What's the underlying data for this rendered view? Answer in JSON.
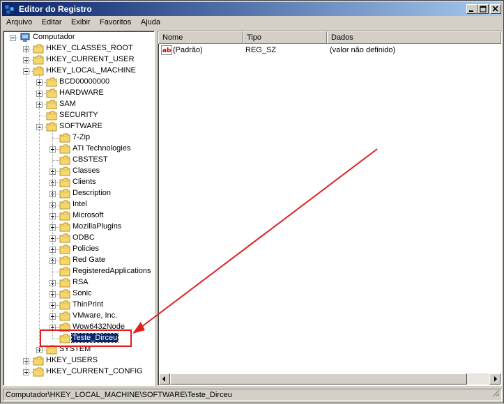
{
  "window": {
    "title": "Editor do Registro"
  },
  "menu": [
    "Arquivo",
    "Editar",
    "Exibir",
    "Favoritos",
    "Ajuda"
  ],
  "tree": [
    {
      "label": "Computador",
      "depth": 0,
      "expander": "minus",
      "icon": "computer-icon"
    },
    {
      "label": "HKEY_CLASSES_ROOT",
      "depth": 1,
      "expander": "plus",
      "icon": "folder-icon"
    },
    {
      "label": "HKEY_CURRENT_USER",
      "depth": 1,
      "expander": "plus",
      "icon": "folder-icon"
    },
    {
      "label": "HKEY_LOCAL_MACHINE",
      "depth": 1,
      "expander": "minus",
      "icon": "folder-icon"
    },
    {
      "label": "BCD00000000",
      "depth": 2,
      "expander": "plus",
      "icon": "folder-icon"
    },
    {
      "label": "HARDWARE",
      "depth": 2,
      "expander": "plus",
      "icon": "folder-icon"
    },
    {
      "label": "SAM",
      "depth": 2,
      "expander": "plus",
      "icon": "folder-icon"
    },
    {
      "label": "SECURITY",
      "depth": 2,
      "expander": "none",
      "icon": "folder-icon"
    },
    {
      "label": "SOFTWARE",
      "depth": 2,
      "expander": "minus",
      "icon": "folder-icon"
    },
    {
      "label": "7-Zip",
      "depth": 3,
      "expander": "none",
      "icon": "folder-icon"
    },
    {
      "label": "ATI Technologies",
      "depth": 3,
      "expander": "plus",
      "icon": "folder-icon"
    },
    {
      "label": "CBSTEST",
      "depth": 3,
      "expander": "none",
      "icon": "folder-icon"
    },
    {
      "label": "Classes",
      "depth": 3,
      "expander": "plus",
      "icon": "folder-icon"
    },
    {
      "label": "Clients",
      "depth": 3,
      "expander": "plus",
      "icon": "folder-icon"
    },
    {
      "label": "Description",
      "depth": 3,
      "expander": "plus",
      "icon": "folder-icon"
    },
    {
      "label": "Intel",
      "depth": 3,
      "expander": "plus",
      "icon": "folder-icon"
    },
    {
      "label": "Microsoft",
      "depth": 3,
      "expander": "plus",
      "icon": "folder-icon"
    },
    {
      "label": "MozillaPlugins",
      "depth": 3,
      "expander": "plus",
      "icon": "folder-icon"
    },
    {
      "label": "ODBC",
      "depth": 3,
      "expander": "plus",
      "icon": "folder-icon"
    },
    {
      "label": "Policies",
      "depth": 3,
      "expander": "plus",
      "icon": "folder-icon"
    },
    {
      "label": "Red Gate",
      "depth": 3,
      "expander": "plus",
      "icon": "folder-icon"
    },
    {
      "label": "RegisteredApplications",
      "depth": 3,
      "expander": "none",
      "icon": "folder-icon"
    },
    {
      "label": "RSA",
      "depth": 3,
      "expander": "plus",
      "icon": "folder-icon"
    },
    {
      "label": "Sonic",
      "depth": 3,
      "expander": "plus",
      "icon": "folder-icon"
    },
    {
      "label": "ThinPrint",
      "depth": 3,
      "expander": "plus",
      "icon": "folder-icon"
    },
    {
      "label": "VMware, Inc.",
      "depth": 3,
      "expander": "plus",
      "icon": "folder-icon"
    },
    {
      "label": "Wow6432Node",
      "depth": 3,
      "expander": "plus",
      "icon": "folder-icon"
    },
    {
      "label": "Teste_Dirceu",
      "depth": 3,
      "expander": "none",
      "icon": "folder-icon",
      "selected": true
    },
    {
      "label": "SYSTEM",
      "depth": 2,
      "expander": "plus",
      "icon": "folder-icon"
    },
    {
      "label": "HKEY_USERS",
      "depth": 1,
      "expander": "plus",
      "icon": "folder-icon"
    },
    {
      "label": "HKEY_CURRENT_CONFIG",
      "depth": 1,
      "expander": "plus",
      "icon": "folder-icon"
    }
  ],
  "list": {
    "columns": [
      "Nome",
      "Tipo",
      "Dados"
    ],
    "rows": [
      {
        "name": "(Padrão)",
        "type": "REG_SZ",
        "data": "(valor não definido)",
        "icon": "string-value-icon"
      }
    ]
  },
  "statusbar": {
    "path": "Computador\\HKEY_LOCAL_MACHINE\\SOFTWARE\\Teste_Dirceu"
  },
  "colors": {
    "titlebar_start": "#0a246a",
    "titlebar_end": "#a6caf0",
    "annotation": "#e02020",
    "selection": "#0a246a"
  }
}
